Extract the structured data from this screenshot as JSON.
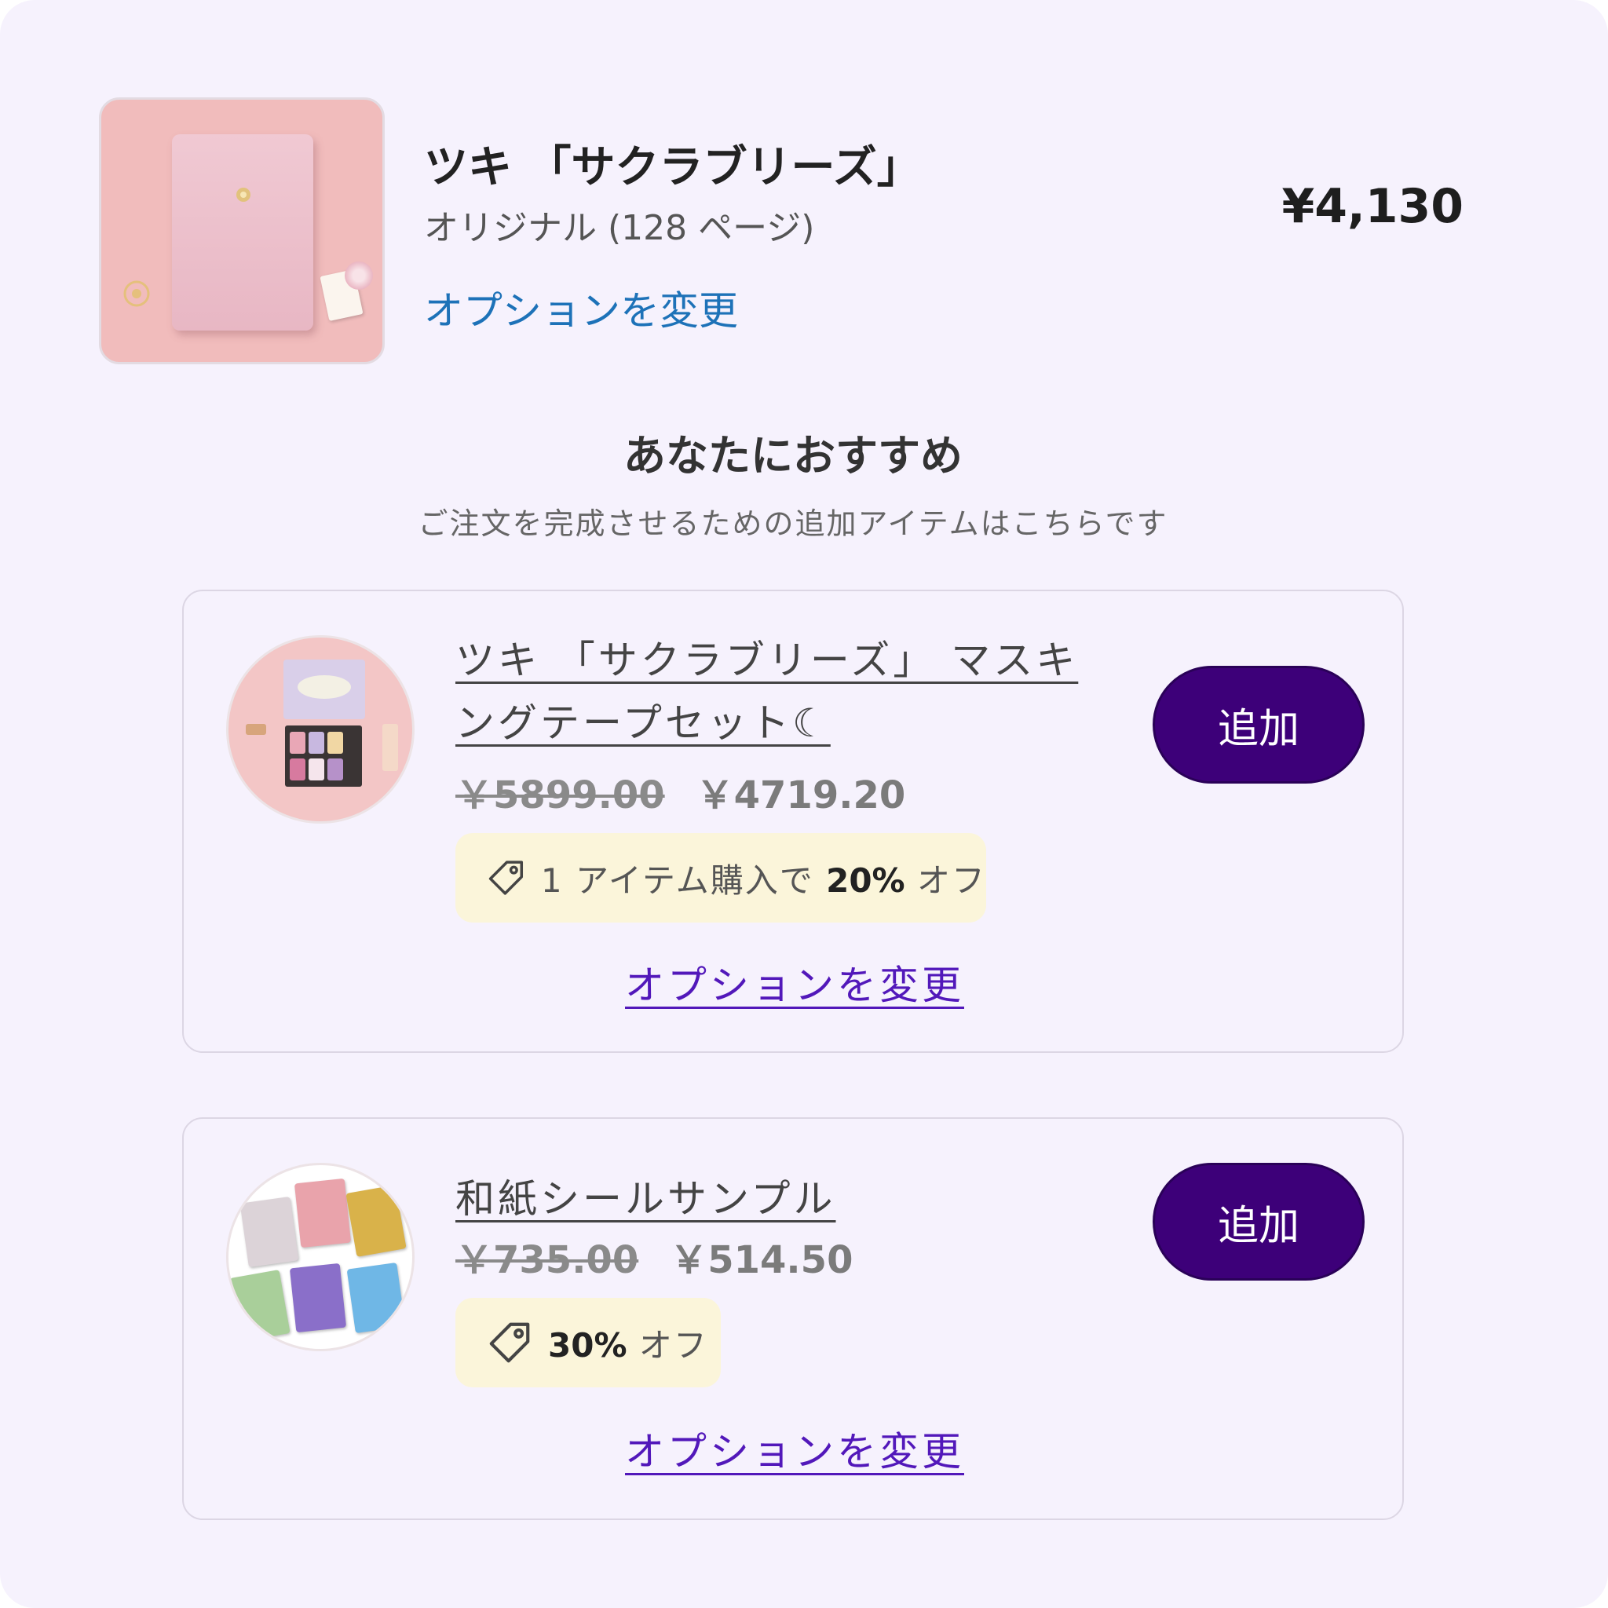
{
  "cart_item": {
    "image_icon": "notebook-image",
    "title": "ツキ 「サクラブリーズ」",
    "variant": "オリジナル (128 ページ)",
    "change_option_label": "オプションを変更",
    "price": "¥4,130"
  },
  "recommendations": {
    "heading": "あなたにおすすめ",
    "subheading": "ご注文を完成させるための追加アイテムはこちらです",
    "items": [
      {
        "title": "ツキ 「サクラブリーズ」 マスキングテープセット☾",
        "original_price": "￥5899.00",
        "sale_price": "￥4719.20",
        "promo_prefix": "1 アイテム購入で ",
        "promo_bold": "20%",
        "promo_suffix": " オフ",
        "change_option_label": "オプションを変更",
        "add_label": "追加",
        "image_icon": "masking-tape-set-image"
      },
      {
        "title": "和紙シールサンプル",
        "original_price": "￥735.00",
        "sale_price": "￥514.50",
        "promo_prefix": "",
        "promo_bold": "30%",
        "promo_suffix": " オフ",
        "change_option_label": "オプションを変更",
        "add_label": "追加",
        "image_icon": "washi-sticker-sample-image"
      }
    ]
  },
  "colors": {
    "background": "#f6f2fd",
    "link_blue": "#1d72b8",
    "link_purple": "#5218ba",
    "button": "#3d0079",
    "promo_bg": "#fbf5da"
  }
}
